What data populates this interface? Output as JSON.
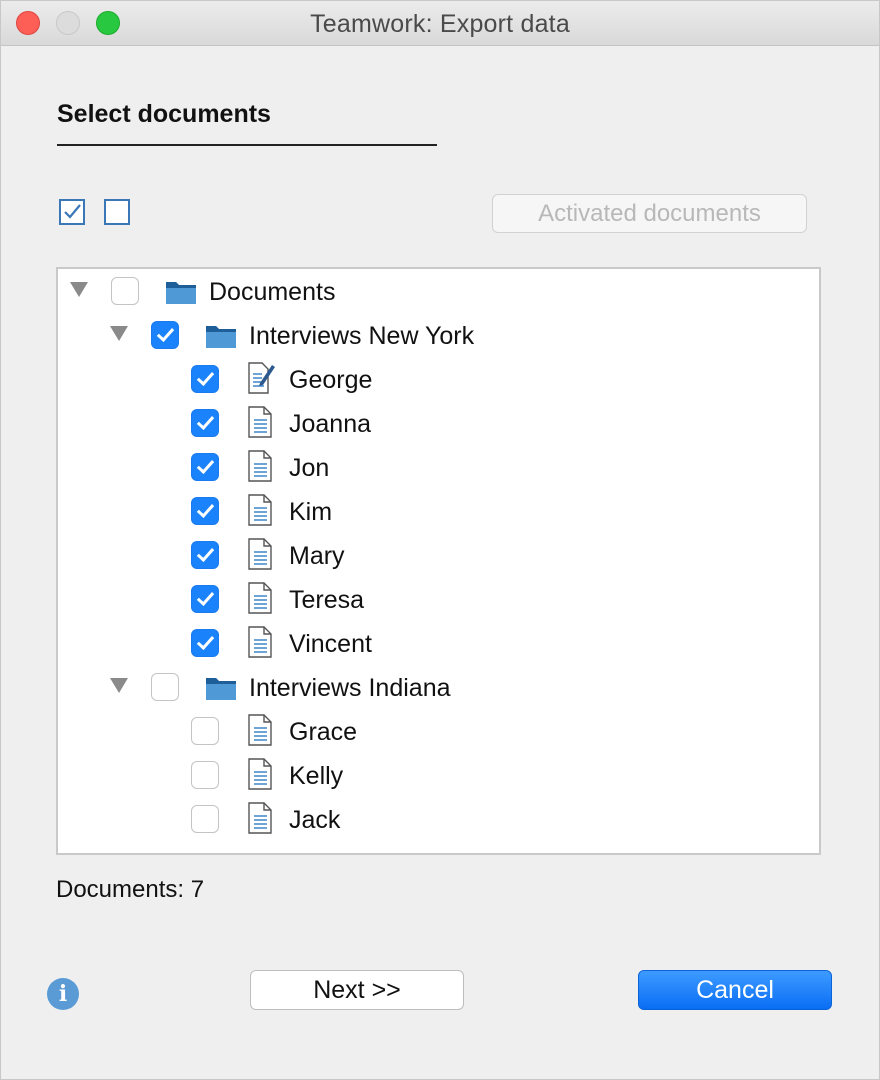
{
  "window": {
    "title": "Teamwork: Export data"
  },
  "section": {
    "title": "Select documents"
  },
  "toolbar": {
    "activated_label": "Activated documents"
  },
  "tree": [
    {
      "label": "Documents",
      "type": "folder",
      "level": 0,
      "checked": false,
      "expanded": true
    },
    {
      "label": "Interviews New York",
      "type": "folder",
      "level": 1,
      "checked": true,
      "expanded": true
    },
    {
      "label": "George",
      "type": "document-memo",
      "level": 2,
      "checked": true
    },
    {
      "label": "Joanna",
      "type": "document",
      "level": 2,
      "checked": true
    },
    {
      "label": "Jon",
      "type": "document",
      "level": 2,
      "checked": true
    },
    {
      "label": "Kim",
      "type": "document",
      "level": 2,
      "checked": true
    },
    {
      "label": "Mary",
      "type": "document",
      "level": 2,
      "checked": true
    },
    {
      "label": "Teresa",
      "type": "document",
      "level": 2,
      "checked": true
    },
    {
      "label": "Vincent",
      "type": "document",
      "level": 2,
      "checked": true
    },
    {
      "label": "Interviews Indiana",
      "type": "folder",
      "level": 1,
      "checked": false,
      "expanded": true
    },
    {
      "label": "Grace",
      "type": "document",
      "level": 2,
      "checked": false
    },
    {
      "label": "Kelly",
      "type": "document",
      "level": 2,
      "checked": false
    },
    {
      "label": "Jack",
      "type": "document",
      "level": 2,
      "checked": false
    }
  ],
  "status": {
    "count_label": "Documents: 7"
  },
  "buttons": {
    "next": "Next >>",
    "cancel": "Cancel"
  },
  "icons": {
    "info": "i"
  },
  "colors": {
    "accent": "#1a82fb",
    "folder": "#4f9ad6"
  }
}
